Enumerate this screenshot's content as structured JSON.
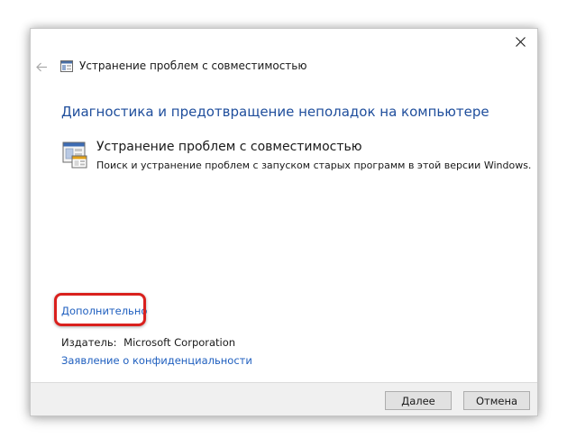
{
  "window": {
    "title": "Устранение проблем с совместимостью",
    "close_icon": "close-icon",
    "back_icon": "back-arrow-icon",
    "title_icon": "troubleshooter-icon"
  },
  "main": {
    "heading": "Диагностика и предотвращение неполадок на компьютере",
    "item": {
      "icon": "compatibility-troubleshooter-icon",
      "title": "Устранение проблем с совместимостью",
      "description": "Поиск и устранение проблем с запуском старых программ в этой версии Windows."
    },
    "advanced_link": "Дополнительно",
    "publisher_label": "Издатель:",
    "publisher_value": "Microsoft Corporation",
    "privacy_link": "Заявление о конфиденциальности"
  },
  "footer": {
    "next_label": "Далее",
    "cancel_label": "Отмена"
  },
  "colors": {
    "heading": "#1f4e9c",
    "link": "#1f5fbf",
    "highlight": "#d9201d"
  }
}
